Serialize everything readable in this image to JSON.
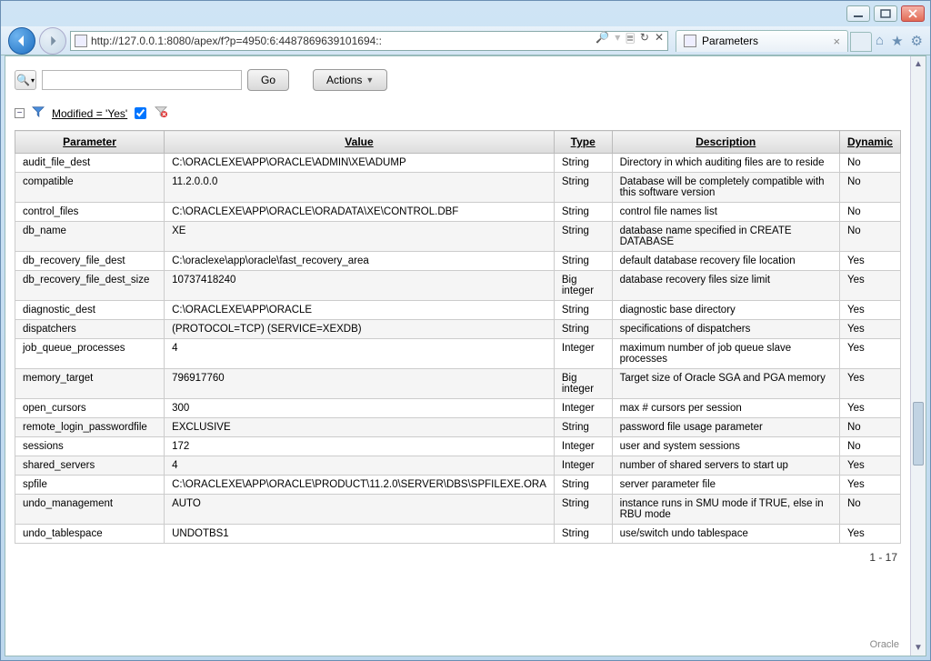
{
  "browser": {
    "url": "http://127.0.0.1:8080/apex/f?p=4950:6:4487869639101694::",
    "tab_title": "Parameters",
    "search_tool": "🔍",
    "refresh": "↻",
    "stop": "✕"
  },
  "apex": {
    "go_label": "Go",
    "actions_label": "Actions",
    "search_placeholder": ""
  },
  "filter": {
    "label": "Modified = 'Yes'"
  },
  "columns": {
    "parameter": "Parameter",
    "value": "Value",
    "type": "Type",
    "description": "Description",
    "dynamic": "Dynamic"
  },
  "pagination": "1 - 17",
  "footer": "Oracle",
  "rows": [
    {
      "p": "audit_file_dest",
      "v": "C:\\ORACLEXE\\APP\\ORACLE\\ADMIN\\XE\\ADUMP",
      "t": "String",
      "d": "Directory in which auditing files are to reside",
      "y": "No"
    },
    {
      "p": "compatible",
      "v": "11.2.0.0.0",
      "t": "String",
      "d": "Database will be completely compatible with this software version",
      "y": "No"
    },
    {
      "p": "control_files",
      "v": "C:\\ORACLEXE\\APP\\ORACLE\\ORADATA\\XE\\CONTROL.DBF",
      "t": "String",
      "d": "control file names list",
      "y": "No"
    },
    {
      "p": "db_name",
      "v": "XE",
      "t": "String",
      "d": "database name specified in CREATE DATABASE",
      "y": "No"
    },
    {
      "p": "db_recovery_file_dest",
      "v": "C:\\oraclexe\\app\\oracle\\fast_recovery_area",
      "t": "String",
      "d": "default database recovery file location",
      "y": "Yes"
    },
    {
      "p": "db_recovery_file_dest_size",
      "v": "10737418240",
      "t": "Big integer",
      "d": "database recovery files size limit",
      "y": "Yes"
    },
    {
      "p": "diagnostic_dest",
      "v": "C:\\ORACLEXE\\APP\\ORACLE",
      "t": "String",
      "d": "diagnostic base directory",
      "y": "Yes"
    },
    {
      "p": "dispatchers",
      "v": "(PROTOCOL=TCP) (SERVICE=XEXDB)",
      "t": "String",
      "d": "specifications of dispatchers",
      "y": "Yes"
    },
    {
      "p": "job_queue_processes",
      "v": "4",
      "t": "Integer",
      "d": "maximum number of job queue slave processes",
      "y": "Yes"
    },
    {
      "p": "memory_target",
      "v": "796917760",
      "t": "Big integer",
      "d": "Target size of Oracle SGA and PGA memory",
      "y": "Yes"
    },
    {
      "p": "open_cursors",
      "v": "300",
      "t": "Integer",
      "d": "max # cursors per session",
      "y": "Yes"
    },
    {
      "p": "remote_login_passwordfile",
      "v": "EXCLUSIVE",
      "t": "String",
      "d": "password file usage parameter",
      "y": "No"
    },
    {
      "p": "sessions",
      "v": "172",
      "t": "Integer",
      "d": "user and system sessions",
      "y": "No"
    },
    {
      "p": "shared_servers",
      "v": "4",
      "t": "Integer",
      "d": "number of shared servers to start up",
      "y": "Yes"
    },
    {
      "p": "spfile",
      "v": "C:\\ORACLEXE\\APP\\ORACLE\\PRODUCT\\11.2.0\\SERVER\\DBS\\SPFILEXE.ORA",
      "t": "String",
      "d": "server parameter file",
      "y": "Yes"
    },
    {
      "p": "undo_management",
      "v": "AUTO",
      "t": "String",
      "d": "instance runs in SMU mode if TRUE, else in RBU mode",
      "y": "No"
    },
    {
      "p": "undo_tablespace",
      "v": "UNDOTBS1",
      "t": "String",
      "d": "use/switch undo tablespace",
      "y": "Yes"
    }
  ]
}
